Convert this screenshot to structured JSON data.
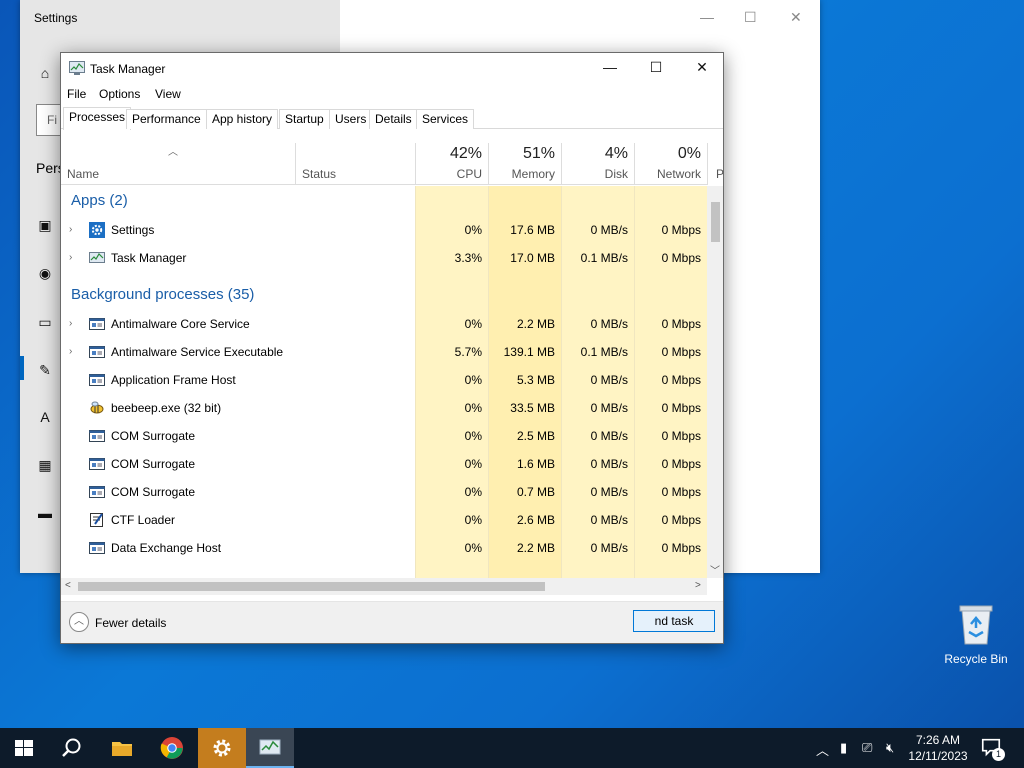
{
  "desktop": {
    "recycle_bin_label": "Recycle Bin"
  },
  "settings_window": {
    "title": "Settings",
    "search_partial": "Fi",
    "section_partial": "Pers"
  },
  "task_manager": {
    "title": "Task Manager",
    "menu": [
      "File",
      "Options",
      "View"
    ],
    "tabs": [
      "Processes",
      "Performance",
      "App history",
      "Startup",
      "Users",
      "Details",
      "Services"
    ],
    "active_tab": "Processes",
    "columns": {
      "name": "Name",
      "status": "Status",
      "cpu": {
        "pct": "42%",
        "label": "CPU"
      },
      "memory": {
        "pct": "51%",
        "label": "Memory"
      },
      "disk": {
        "pct": "4%",
        "label": "Disk"
      },
      "network": {
        "pct": "0%",
        "label": "Network"
      },
      "power_partial": "P"
    },
    "groups": {
      "apps": "Apps (2)",
      "background": "Background processes (35)"
    },
    "apps": [
      {
        "name": "Settings",
        "cpu": "0%",
        "memory": "17.6 MB",
        "disk": "0 MB/s",
        "network": "0 Mbps",
        "icon": "gear-icon",
        "expand": true
      },
      {
        "name": "Task Manager",
        "cpu": "3.3%",
        "memory": "17.0 MB",
        "disk": "0.1 MB/s",
        "network": "0 Mbps",
        "icon": "task-manager-icon",
        "expand": true
      }
    ],
    "background": [
      {
        "name": "Antimalware Core Service",
        "cpu": "0%",
        "memory": "2.2 MB",
        "disk": "0 MB/s",
        "network": "0 Mbps",
        "icon": "service-icon",
        "expand": true
      },
      {
        "name": "Antimalware Service Executable",
        "cpu": "5.7%",
        "memory": "139.1 MB",
        "disk": "0.1 MB/s",
        "network": "0 Mbps",
        "icon": "service-icon",
        "expand": true
      },
      {
        "name": "Application Frame Host",
        "cpu": "0%",
        "memory": "5.3 MB",
        "disk": "0 MB/s",
        "network": "0 Mbps",
        "icon": "service-icon",
        "expand": false
      },
      {
        "name": "beebeep.exe (32 bit)",
        "cpu": "0%",
        "memory": "33.5 MB",
        "disk": "0 MB/s",
        "network": "0 Mbps",
        "icon": "bee-icon",
        "expand": false
      },
      {
        "name": "COM Surrogate",
        "cpu": "0%",
        "memory": "2.5 MB",
        "disk": "0 MB/s",
        "network": "0 Mbps",
        "icon": "service-icon",
        "expand": false
      },
      {
        "name": "COM Surrogate",
        "cpu": "0%",
        "memory": "1.6 MB",
        "disk": "0 MB/s",
        "network": "0 Mbps",
        "icon": "service-icon",
        "expand": false
      },
      {
        "name": "COM Surrogate",
        "cpu": "0%",
        "memory": "0.7 MB",
        "disk": "0 MB/s",
        "network": "0 Mbps",
        "icon": "service-icon",
        "expand": false
      },
      {
        "name": "CTF Loader",
        "cpu": "0%",
        "memory": "2.6 MB",
        "disk": "0 MB/s",
        "network": "0 Mbps",
        "icon": "ctf-icon",
        "expand": false
      },
      {
        "name": "Data Exchange Host",
        "cpu": "0%",
        "memory": "2.2 MB",
        "disk": "0 MB/s",
        "network": "0 Mbps",
        "icon": "service-icon",
        "expand": false
      }
    ],
    "footer": {
      "fewer_details": "Fewer details",
      "end_task_partial": "nd task"
    }
  },
  "taskbar": {
    "time": "7:26 AM",
    "date": "12/11/2023",
    "notification_count": "1",
    "apps": [
      "start-icon",
      "search-icon",
      "file-explorer-icon",
      "chrome-icon",
      "settings-icon",
      "task-manager-icon"
    ]
  },
  "colors": {
    "group_header": "#1a5ea8",
    "heat_light": "#fff4c4",
    "heat_mid": "#ffefb0",
    "taskbar": "#0d1b2a",
    "active_taskbar_app": "#c47d1e"
  }
}
